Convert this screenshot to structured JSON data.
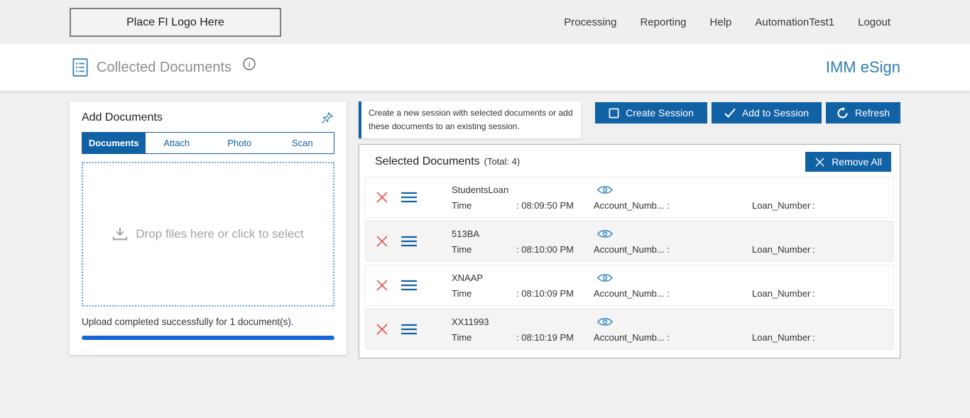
{
  "topbar": {
    "logo_placeholder": "Place FI Logo Here",
    "nav": [
      {
        "label": "Processing"
      },
      {
        "label": "Reporting"
      },
      {
        "label": "Help"
      },
      {
        "label": "AutomationTest1"
      },
      {
        "label": "Logout"
      }
    ]
  },
  "header": {
    "title": "Collected Documents",
    "brand": "IMM eSign"
  },
  "add_documents": {
    "title": "Add Documents",
    "tabs": [
      {
        "label": "Documents",
        "active": true
      },
      {
        "label": "Attach",
        "active": false
      },
      {
        "label": "Photo",
        "active": false
      },
      {
        "label": "Scan",
        "active": false
      }
    ],
    "dropzone_text": "Drop files here or click to select",
    "upload_status": "Upload completed successfully for 1 document(s).",
    "progress_percent": 100
  },
  "session": {
    "info_text": "Create a new session with selected documents or add these documents to an existing session.",
    "buttons": [
      {
        "label": "Create Session"
      },
      {
        "label": "Add to Session"
      },
      {
        "label": "Refresh"
      }
    ]
  },
  "selected_documents": {
    "title": "Selected Documents",
    "total_label": "(Total: 4)",
    "remove_all_label": "Remove All",
    "labels": {
      "time": "Time",
      "account": "Account_Numb... :",
      "loan": "Loan_Number",
      "loan_colon": ":"
    },
    "rows": [
      {
        "name": "StudentsLoan",
        "time": ": 08:09:50 PM"
      },
      {
        "name": "513BA",
        "time": ": 08:10:00 PM"
      },
      {
        "name": "XNAAP",
        "time": ": 08:10:09 PM"
      },
      {
        "name": "XX11993",
        "time": ": 08:10:19 PM"
      }
    ]
  },
  "colors": {
    "primary_blue": "#1161a5",
    "brand_blue": "#2f7fb5",
    "progress_blue": "#1665d8",
    "danger_red": "#e25757"
  }
}
